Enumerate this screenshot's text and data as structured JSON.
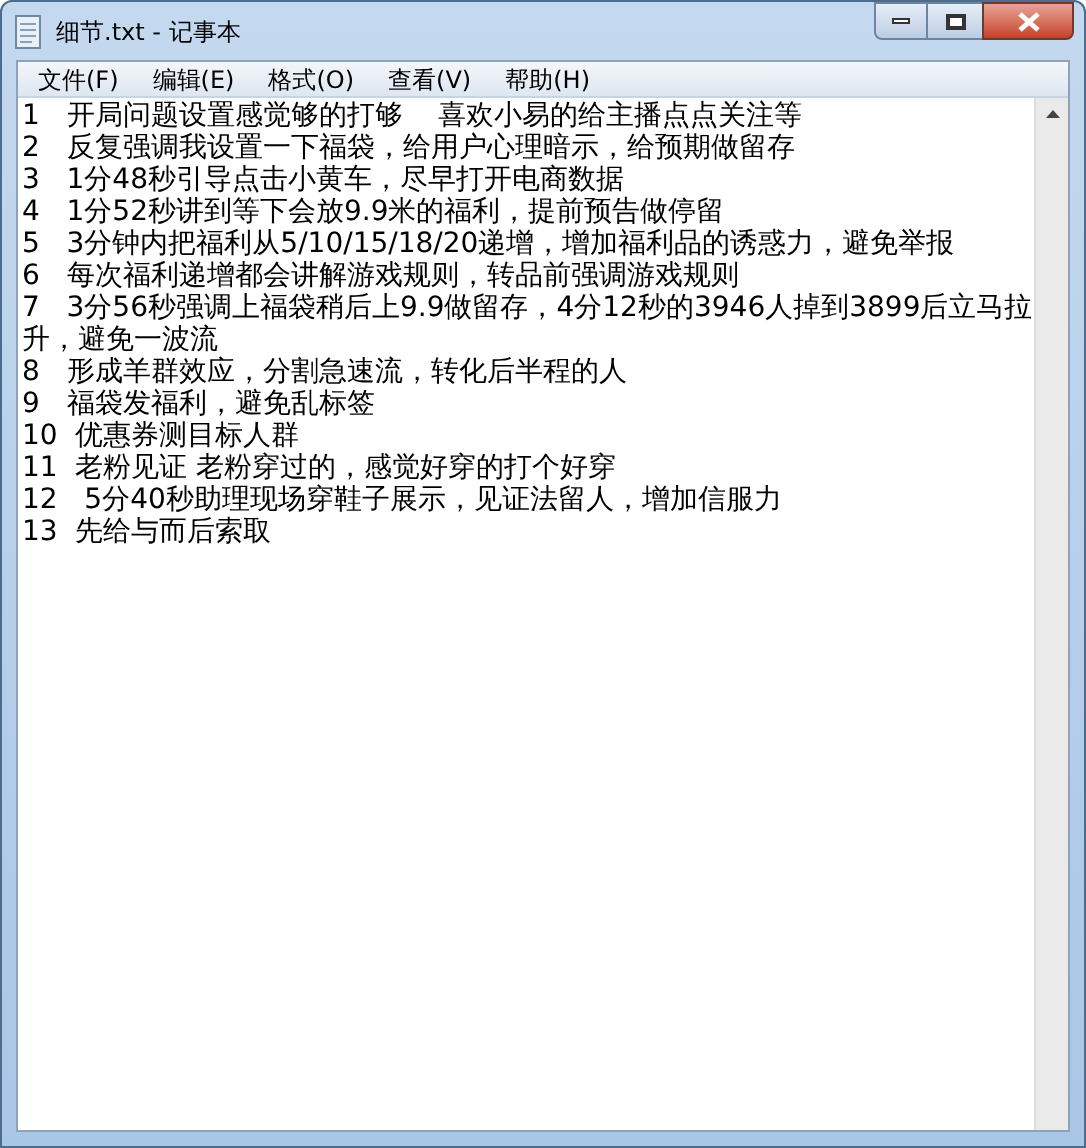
{
  "window": {
    "title": "细节.txt - 记事本"
  },
  "menu": [
    "文件(F)",
    "编辑(E)",
    "格式(O)",
    "查看(V)",
    "帮助(H)"
  ],
  "lines": [
    "1   开局问题设置感觉够的打够    喜欢小易的给主播点点关注等",
    "2   反复强调我设置一下福袋，给用户心理暗示，给预期做留存",
    "3   1分48秒引导点击小黄车，尽早打开电商数据",
    "4   1分52秒讲到等下会放9.9米的福利，提前预告做停留",
    "5   3分钟内把福利从5/10/15/18/20递增，增加福利品的诱惑力，避免举报",
    "6   每次福利递增都会讲解游戏规则，转品前强调游戏规则",
    "7   3分56秒强调上福袋稍后上9.9做留存，4分12秒的3946人掉到3899后立马拉升，避免一波流",
    "8   形成羊群效应，分割急速流，转化后半程的人",
    "9   福袋发福利，避免乱标签",
    "10  优惠券测目标人群",
    "11  老粉见证 老粉穿过的，感觉好穿的打个好穿",
    "12   5分40秒助理现场穿鞋子展示，见证法留人，增加信服力",
    "13  先给与而后索取"
  ]
}
